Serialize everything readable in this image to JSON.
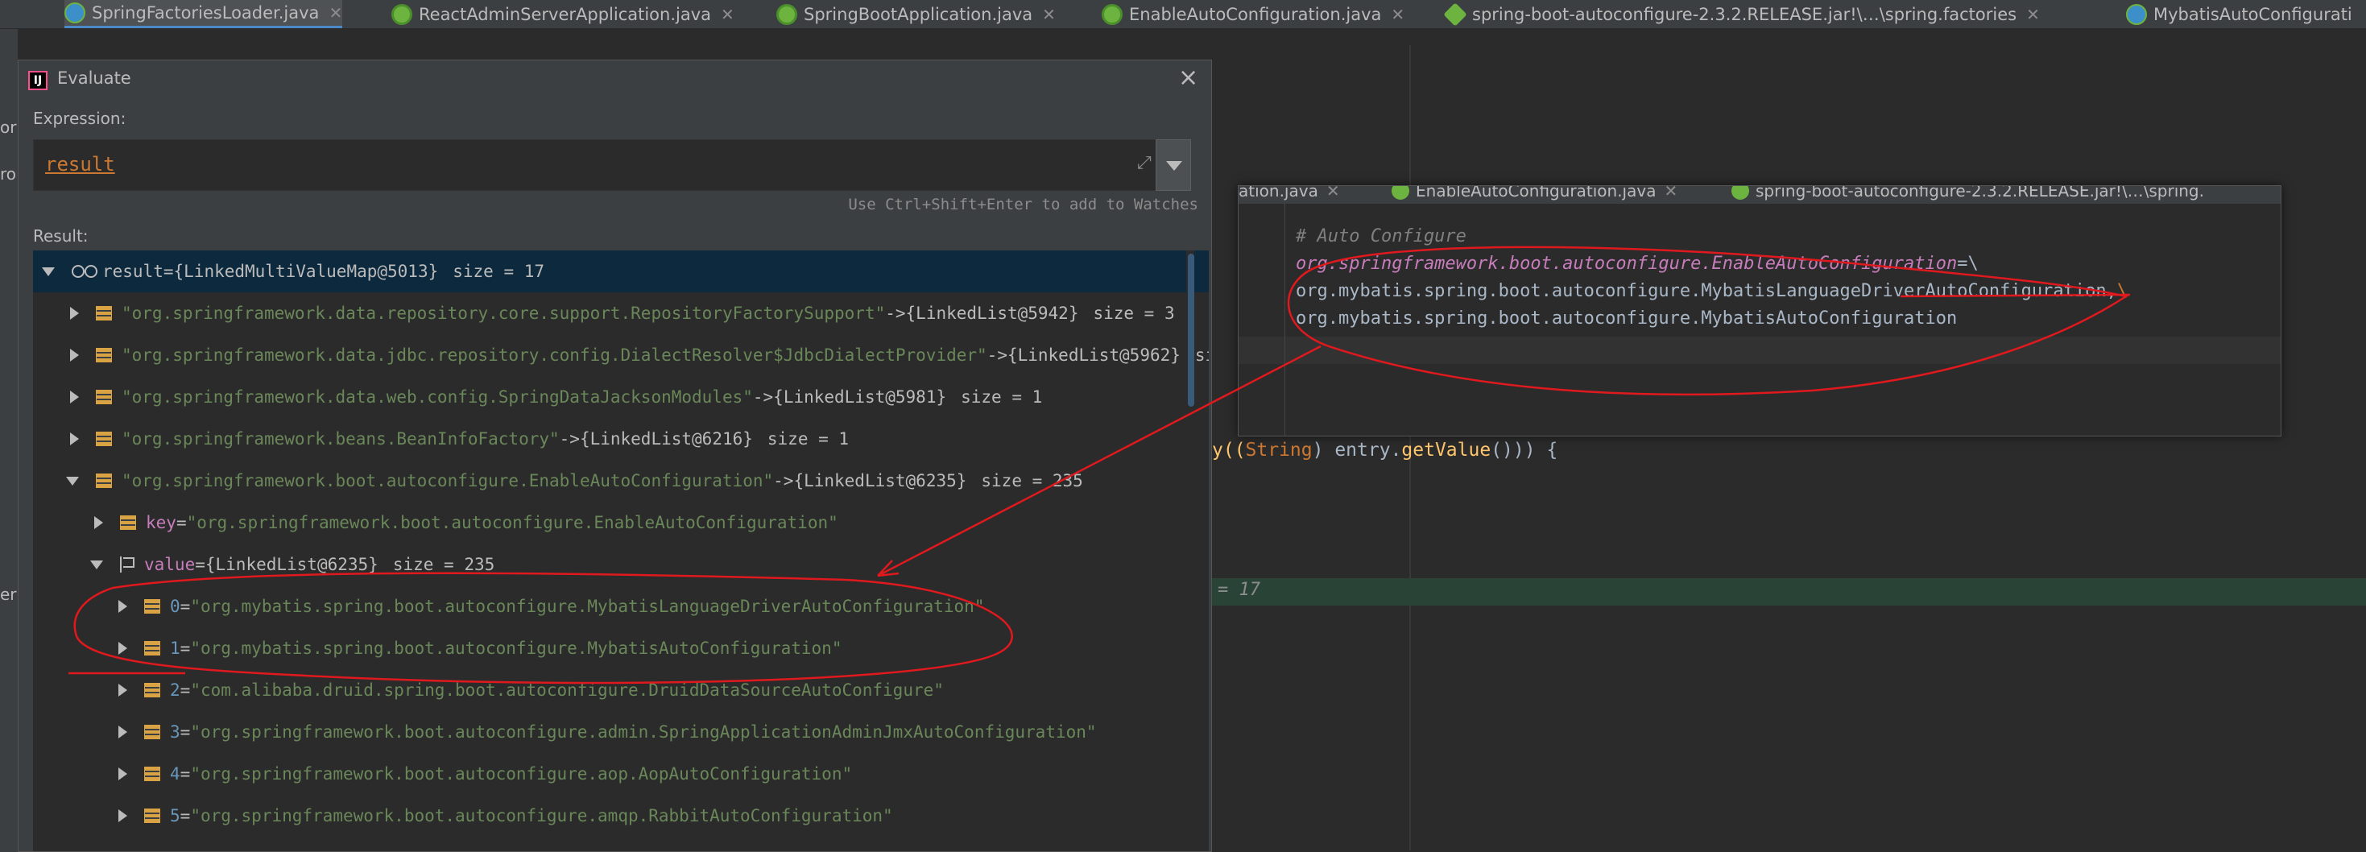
{
  "tabs": [
    {
      "label": "SpringFactoriesLoader.java",
      "icon": "class-icon",
      "active": true,
      "closable": true
    },
    {
      "label": "ReactAdminServerApplication.java",
      "icon": "spring-boot-icon",
      "active": false,
      "closable": true
    },
    {
      "label": "SpringBootApplication.java",
      "icon": "spring-boot-icon",
      "active": false,
      "closable": true
    },
    {
      "label": "EnableAutoConfiguration.java",
      "icon": "spring-boot-icon",
      "active": false,
      "closable": true
    },
    {
      "label": "spring-boot-autoconfigure-2.3.2.RELEASE.jar!\\…\\spring.factories",
      "icon": "jar-icon",
      "active": false,
      "closable": true
    },
    {
      "label": "MybatisAutoConfigurati",
      "icon": "class-icon",
      "active": false,
      "closable": false
    }
  ],
  "left_strip_chars": [
    "or",
    "ro",
    "er"
  ],
  "editor": {
    "code_line": {
      "prefix": "y((",
      "type": "String",
      "middle": ") entry.",
      "method": "getValue",
      "suffix": "())) {"
    },
    "highlight_text": "= 17",
    "preview": {
      "tabs": [
        "ation.java",
        "EnableAutoConfiguration.java",
        "spring-boot-autoconfigure-2.3.2.RELEASE.jar!\\…\\spring."
      ],
      "lines": {
        "comment": "# Auto Configure",
        "key": "org.springframework.boot.autoconfigure.EnableAutoConfiguration",
        "key_suffix": "=\\",
        "line2": "org.mybatis.spring.boot.autoconfigure.MybatisLanguageDriverAutoConfiguration,",
        "line2_esc": "\\",
        "line3": "org.mybatis.spring.boot.autoconfigure.MybatisAutoConfiguration"
      }
    }
  },
  "dialog": {
    "title": "Evaluate",
    "logo_text": "IJ",
    "close": "×",
    "expression_label": "Expression:",
    "expression": "result",
    "expand": "⤢",
    "watch_hint": "Use Ctrl+Shift+Enter to add to Watches",
    "result_label": "Result:",
    "tree": [
      {
        "name": "result",
        "eq": " = ",
        "obj": "{LinkedMultiValueMap@5013}",
        "size": "size = 17"
      },
      {
        "str": "\"org.springframework.data.repository.core.support.RepositoryFactorySupport\"",
        "arrow": " -> ",
        "obj": "{LinkedList@5942}",
        "size": "size = 3"
      },
      {
        "str": "\"org.springframework.data.jdbc.repository.config.DialectResolver$JdbcDialectProvider\"",
        "arrow": " -> ",
        "obj": "{LinkedList@5962}",
        "size": "size"
      },
      {
        "str": "\"org.springframework.data.web.config.SpringDataJacksonModules\"",
        "arrow": " -> ",
        "obj": "{LinkedList@5981}",
        "size": "size = 1"
      },
      {
        "str": "\"org.springframework.beans.BeanInfoFactory\"",
        "arrow": " -> ",
        "obj": "{LinkedList@6216}",
        "size": "size = 1"
      },
      {
        "str": "\"org.springframework.boot.autoconfigure.EnableAutoConfiguration\"",
        "arrow": " -> ",
        "obj": "{LinkedList@6235}",
        "size": "size = 235"
      },
      {
        "key": "key",
        "eq": " = ",
        "str": "\"org.springframework.boot.autoconfigure.EnableAutoConfiguration\""
      },
      {
        "key": "value",
        "eq": " = ",
        "obj": "{LinkedList@6235}",
        "size": "size = 235"
      },
      {
        "idx": "0",
        "eq": " = ",
        "str": "\"org.mybatis.spring.boot.autoconfigure.MybatisLanguageDriverAutoConfiguration\""
      },
      {
        "idx": "1",
        "eq": " = ",
        "str": "\"org.mybatis.spring.boot.autoconfigure.MybatisAutoConfiguration\""
      },
      {
        "idx": "2",
        "eq": " = ",
        "str": "\"com.alibaba.druid.spring.boot.autoconfigure.DruidDataSourceAutoConfigure\""
      },
      {
        "idx": "3",
        "eq": " = ",
        "str": "\"org.springframework.boot.autoconfigure.admin.SpringApplicationAdminJmxAutoConfiguration\""
      },
      {
        "idx": "4",
        "eq": " = ",
        "str": "\"org.springframework.boot.autoconfigure.aop.AopAutoConfiguration\""
      },
      {
        "idx": "5",
        "eq": " = ",
        "str": "\"org.springframework.boot.autoconfigure.amqp.RabbitAutoConfiguration\""
      }
    ]
  },
  "colors": {
    "annotation": "#e0191e",
    "selection": "#0d293e",
    "highlight_line": "#294436"
  }
}
